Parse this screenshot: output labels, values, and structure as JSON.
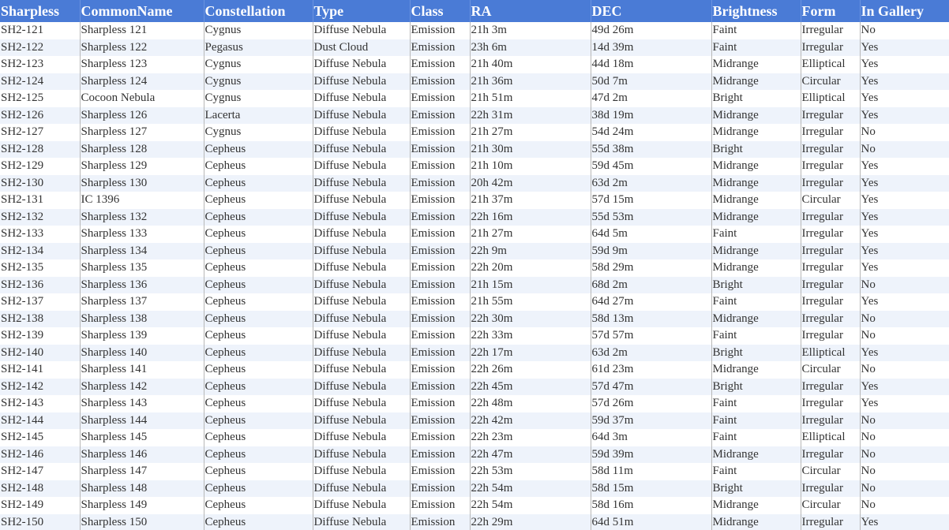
{
  "colors": {
    "header_bg": "#4a7bd6",
    "header_text": "#ffffff",
    "row_alt_bg": "#eef3fb",
    "cell_text": "#333333"
  },
  "table": {
    "columns": [
      "Sharpless",
      "CommonName",
      "Constellation",
      "Type",
      "Class",
      "RA",
      "DEC",
      "Brightness",
      "Form",
      "In Gallery"
    ],
    "rows": [
      [
        "SH2-121",
        "Sharpless 121",
        "Cygnus",
        "Diffuse Nebula",
        "Emission",
        "21h 3m",
        "49d 26m",
        "Faint",
        "Irregular",
        "No"
      ],
      [
        "SH2-122",
        "Sharpless 122",
        "Pegasus",
        "Dust Cloud",
        "Emission",
        "23h 6m",
        "14d 39m",
        "Faint",
        "Irregular",
        "Yes"
      ],
      [
        "SH2-123",
        "Sharpless 123",
        "Cygnus",
        "Diffuse Nebula",
        "Emission",
        "21h 40m",
        "44d 18m",
        "Midrange",
        "Elliptical",
        "Yes"
      ],
      [
        "SH2-124",
        "Sharpless 124",
        "Cygnus",
        "Diffuse Nebula",
        "Emission",
        "21h 36m",
        "50d 7m",
        "Midrange",
        "Circular",
        "Yes"
      ],
      [
        "SH2-125",
        "Cocoon Nebula",
        "Cygnus",
        "Diffuse Nebula",
        "Emission",
        "21h 51m",
        "47d 2m",
        "Bright",
        "Elliptical",
        "Yes"
      ],
      [
        "SH2-126",
        "Sharpless 126",
        "Lacerta",
        "Diffuse Nebula",
        "Emission",
        "22h 31m",
        "38d 19m",
        "Midrange",
        "Irregular",
        "Yes"
      ],
      [
        "SH2-127",
        "Sharpless 127",
        "Cygnus",
        "Diffuse Nebula",
        "Emission",
        "21h 27m",
        "54d 24m",
        "Midrange",
        "Irregular",
        "No"
      ],
      [
        "SH2-128",
        "Sharpless 128",
        "Cepheus",
        "Diffuse Nebula",
        "Emission",
        "21h 30m",
        "55d 38m",
        "Bright",
        "Irregular",
        "No"
      ],
      [
        "SH2-129",
        "Sharpless 129",
        "Cepheus",
        "Diffuse Nebula",
        "Emission",
        "21h 10m",
        "59d 45m",
        "Midrange",
        "Irregular",
        "Yes"
      ],
      [
        "SH2-130",
        "Sharpless 130",
        "Cepheus",
        "Diffuse Nebula",
        "Emission",
        "20h 42m",
        "63d 2m",
        "Midrange",
        "Irregular",
        "Yes"
      ],
      [
        "SH2-131",
        "IC 1396",
        "Cepheus",
        "Diffuse Nebula",
        "Emission",
        "21h 37m",
        "57d 15m",
        "Midrange",
        "Circular",
        "Yes"
      ],
      [
        "SH2-132",
        "Sharpless 132",
        "Cepheus",
        "Diffuse Nebula",
        "Emission",
        "22h 16m",
        "55d 53m",
        "Midrange",
        "Irregular",
        "Yes"
      ],
      [
        "SH2-133",
        "Sharpless 133",
        "Cepheus",
        "Diffuse Nebula",
        "Emission",
        "21h 27m",
        "64d 5m",
        "Faint",
        "Irregular",
        "Yes"
      ],
      [
        "SH2-134",
        "Sharpless 134",
        "Cepheus",
        "Diffuse Nebula",
        "Emission",
        "22h 9m",
        "59d 9m",
        "Midrange",
        "Irregular",
        "Yes"
      ],
      [
        "SH2-135",
        "Sharpless 135",
        "Cepheus",
        "Diffuse Nebula",
        "Emission",
        "22h 20m",
        "58d 29m",
        "Midrange",
        "Irregular",
        "Yes"
      ],
      [
        "SH2-136",
        "Sharpless 136",
        "Cepheus",
        "Diffuse Nebula",
        "Emission",
        "21h 15m",
        "68d 2m",
        "Bright",
        "Irregular",
        "No"
      ],
      [
        "SH2-137",
        "Sharpless 137",
        "Cepheus",
        "Diffuse Nebula",
        "Emission",
        "21h 55m",
        "64d 27m",
        "Faint",
        "Irregular",
        "Yes"
      ],
      [
        "SH2-138",
        "Sharpless 138",
        "Cepheus",
        "Diffuse Nebula",
        "Emission",
        "22h 30m",
        "58d 13m",
        "Midrange",
        "Irregular",
        "No"
      ],
      [
        "SH2-139",
        "Sharpless 139",
        "Cepheus",
        "Diffuse Nebula",
        "Emission",
        "22h 33m",
        "57d 57m",
        "Faint",
        "Irregular",
        "No"
      ],
      [
        "SH2-140",
        "Sharpless 140",
        "Cepheus",
        "Diffuse Nebula",
        "Emission",
        "22h 17m",
        "63d 2m",
        "Bright",
        "Elliptical",
        "Yes"
      ],
      [
        "SH2-141",
        "Sharpless 141",
        "Cepheus",
        "Diffuse Nebula",
        "Emission",
        "22h 26m",
        "61d 23m",
        "Midrange",
        "Circular",
        "No"
      ],
      [
        "SH2-142",
        "Sharpless 142",
        "Cepheus",
        "Diffuse Nebula",
        "Emission",
        "22h 45m",
        "57d 47m",
        "Bright",
        "Irregular",
        "Yes"
      ],
      [
        "SH2-143",
        "Sharpless 143",
        "Cepheus",
        "Diffuse Nebula",
        "Emission",
        "22h 48m",
        "57d 26m",
        "Faint",
        "Irregular",
        "Yes"
      ],
      [
        "SH2-144",
        "Sharpless 144",
        "Cepheus",
        "Diffuse Nebula",
        "Emission",
        "22h 42m",
        "59d 37m",
        "Faint",
        "Irregular",
        "No"
      ],
      [
        "SH2-145",
        "Sharpless 145",
        "Cepheus",
        "Diffuse Nebula",
        "Emission",
        "22h 23m",
        "64d 3m",
        "Faint",
        "Elliptical",
        "No"
      ],
      [
        "SH2-146",
        "Sharpless 146",
        "Cepheus",
        "Diffuse Nebula",
        "Emission",
        "22h 47m",
        "59d 39m",
        "Midrange",
        "Irregular",
        "No"
      ],
      [
        "SH2-147",
        "Sharpless 147",
        "Cepheus",
        "Diffuse Nebula",
        "Emission",
        "22h 53m",
        "58d 11m",
        "Faint",
        "Circular",
        "No"
      ],
      [
        "SH2-148",
        "Sharpless 148",
        "Cepheus",
        "Diffuse Nebula",
        "Emission",
        "22h 54m",
        "58d 15m",
        "Bright",
        "Irregular",
        "No"
      ],
      [
        "SH2-149",
        "Sharpless 149",
        "Cepheus",
        "Diffuse Nebula",
        "Emission",
        "22h 54m",
        "58d 16m",
        "Midrange",
        "Circular",
        "No"
      ],
      [
        "SH2-150",
        "Sharpless 150",
        "Cepheus",
        "Diffuse Nebula",
        "Emission",
        "22h 29m",
        "64d 51m",
        "Midrange",
        "Irregular",
        "Yes"
      ]
    ]
  }
}
